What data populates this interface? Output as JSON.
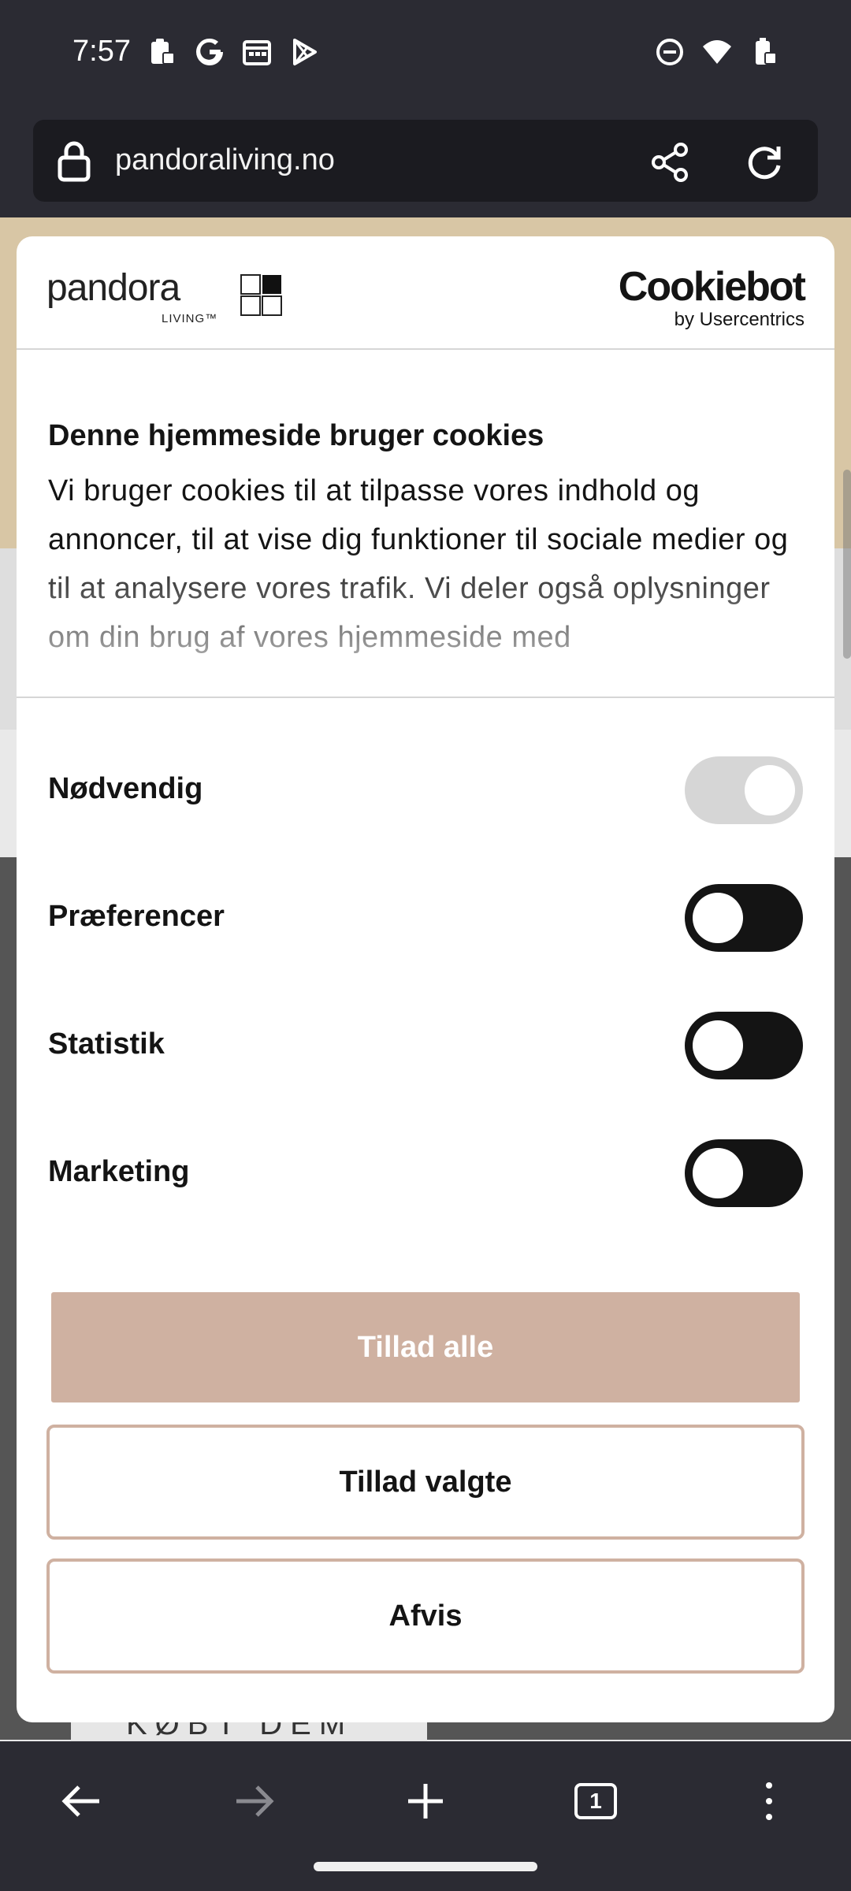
{
  "status_bar": {
    "time": "7:57"
  },
  "browser": {
    "url": "pandoraliving.no",
    "tab_count": "1"
  },
  "background_page": {
    "button_text": "KØBT DEM HER"
  },
  "consent": {
    "brand_word": "pandora",
    "brand_sub": "LIVING™",
    "provider_word": "Cookiebot",
    "provider_sub": "by Usercentrics",
    "title": "Denne hjemmeside bruger cookies",
    "description": "Vi bruger cookies til at tilpasse vores indhold og annoncer, til at vise dig funktioner til sociale medier og til at analysere vores trafik. Vi deler også oplysninger om din brug af vores hjemmeside med",
    "toggles": [
      {
        "label": "Nødvendig",
        "enabled": true,
        "disabled": true
      },
      {
        "label": "Præferencer",
        "enabled": false,
        "disabled": false
      },
      {
        "label": "Statistik",
        "enabled": false,
        "disabled": false
      },
      {
        "label": "Marketing",
        "enabled": false,
        "disabled": false
      }
    ],
    "buttons": {
      "allow_all": "Tillad alle",
      "allow_selected": "Tillad valgte",
      "reject": "Afvis"
    },
    "accent_color": "#cfb1a1"
  }
}
